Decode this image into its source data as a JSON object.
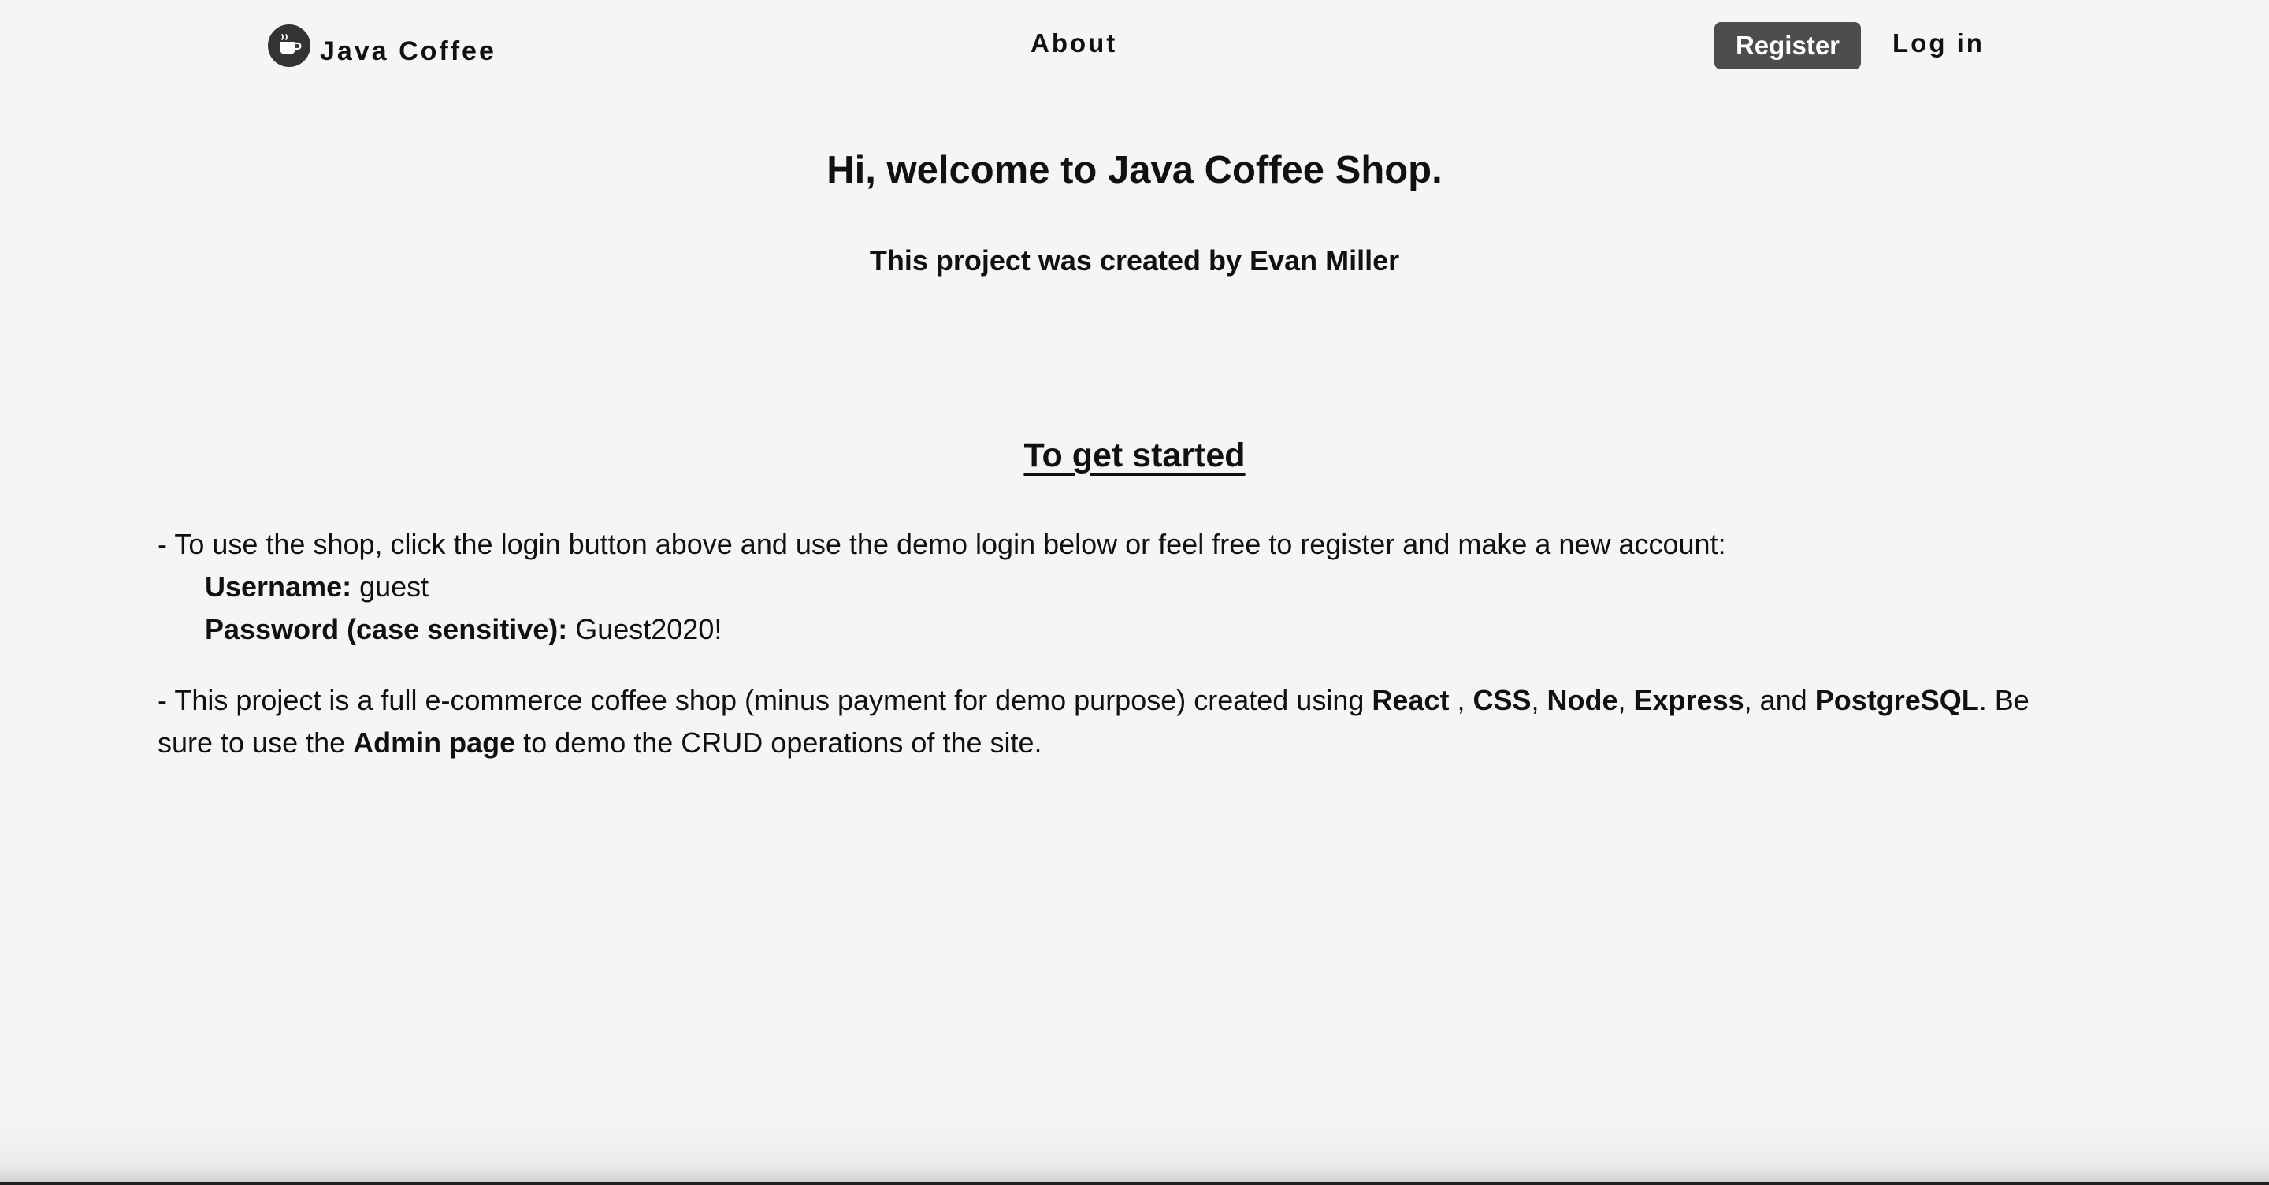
{
  "nav": {
    "brand_text": "Java Coffee",
    "brand_icon": "coffee-cup-icon",
    "about_label": "About",
    "register_label": "Register",
    "login_label": "Log in"
  },
  "main": {
    "title": "Hi, welcome to Java Coffee Shop.",
    "credit": "This project was created by Evan Miller",
    "section_heading": "To get started",
    "intro_line": "- To use the shop, click the login button above and use the demo login below or feel free to register and make a new account:",
    "username_label": "Username:",
    "username_value": " guest",
    "password_label": "Password (case sensitive):",
    "password_value": " Guest2020!",
    "p2_start": "- This project is a full e-commerce coffee shop (minus payment for demo purpose) created using ",
    "tech_react": "React",
    "sep_1": " , ",
    "tech_css": "CSS",
    "sep_2": ", ",
    "tech_node": "Node",
    "sep_3": ", ",
    "tech_express": "Express",
    "sep_4": ", and ",
    "tech_postgres": "PostgreSQL",
    "p2_mid": ". Be sure to use the ",
    "admin_page": "Admin page",
    "p2_end": " to demo the CRUD operations of the site."
  },
  "colors": {
    "background": "#f5f5f5",
    "register_button": "#4d4d4d",
    "text": "#111111"
  }
}
